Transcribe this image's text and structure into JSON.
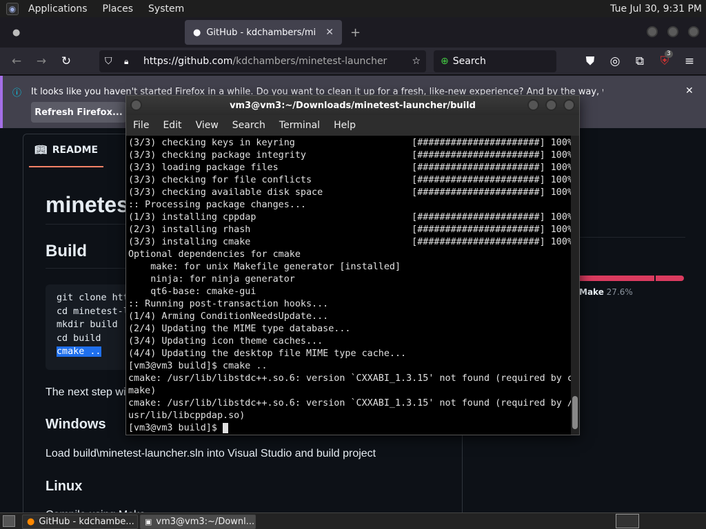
{
  "panel": {
    "menus": [
      "Applications",
      "Places",
      "System"
    ],
    "clock": "Tue Jul 30,  9:31 PM"
  },
  "browser": {
    "tabs": [
      {
        "label": ""
      },
      {
        "label": "GitHub - kdchambers/mine"
      }
    ],
    "url_host": "https://github.com",
    "url_path": "/kdchambers/minetest-launcher",
    "search_placeholder": "Search",
    "extension_badge": "3",
    "infobar": {
      "message": "It looks like you haven't started Firefox in a while. Do you want to clean it up for a fresh, like-new experience? And by the way, welcome back!",
      "button": "Refresh Firefox..."
    }
  },
  "page": {
    "readme_tab": "README",
    "title": "minetest-launcher",
    "build_heading": "Build",
    "code_lines": [
      "git clone https://github.com/kdchambers/minetest-launcher",
      "cd minetest-launcher",
      "mkdir build",
      "cd build"
    ],
    "code_selected": "cmake ..",
    "next_step": "The next step will depend on your platform",
    "windows_heading": "Windows",
    "windows_text": "Load build\\minetest-launcher.sln into Visual Studio and build project",
    "linux_heading": "Linux",
    "linux_text": "Compile using Make",
    "lang_label": "Make",
    "lang_pct": "27.6%",
    "lang_fraction": 0.276
  },
  "terminal": {
    "title": "vm3@vm3:~/Downloads/minetest-launcher/build",
    "menu": [
      "File",
      "Edit",
      "View",
      "Search",
      "Terminal",
      "Help"
    ],
    "lines": [
      "(3/3) checking keys in keyring                     [######################] 100%",
      "(3/3) checking package integrity                   [######################] 100%",
      "(3/3) loading package files                        [######################] 100%",
      "(3/3) checking for file conflicts                  [######################] 100%",
      "(3/3) checking available disk space                [######################] 100%",
      ":: Processing package changes...",
      "(1/3) installing cppdap                            [######################] 100%",
      "(2/3) installing rhash                             [######################] 100%",
      "(3/3) installing cmake                             [######################] 100%",
      "Optional dependencies for cmake",
      "    make: for unix Makefile generator [installed]",
      "    ninja: for ninja generator",
      "    qt6-base: cmake-gui",
      ":: Running post-transaction hooks...",
      "(1/4) Arming ConditionNeedsUpdate...",
      "(2/4) Updating the MIME type database...",
      "(3/4) Updating icon theme caches...",
      "(4/4) Updating the desktop file MIME type cache...",
      "[vm3@vm3 build]$ cmake ..",
      "cmake: /usr/lib/libstdc++.so.6: version `CXXABI_1.3.15' not found (required by c",
      "make)",
      "cmake: /usr/lib/libstdc++.so.6: version `CXXABI_1.3.15' not found (required by /",
      "usr/lib/libcppdap.so)"
    ],
    "prompt": "[vm3@vm3 build]$ "
  },
  "taskbar": {
    "items": [
      {
        "label": "GitHub - kdchambe..."
      },
      {
        "label": "vm3@vm3:~/Downl..."
      }
    ]
  }
}
